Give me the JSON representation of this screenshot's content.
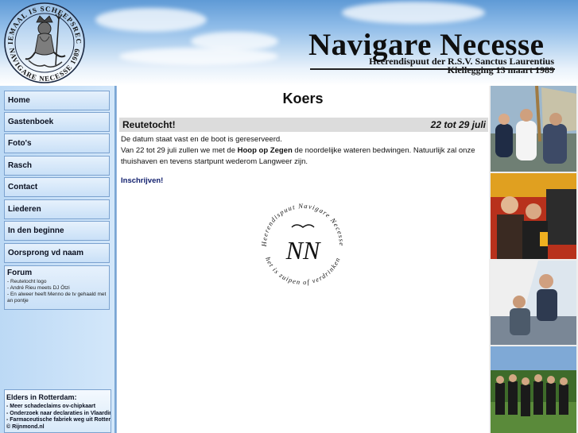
{
  "header": {
    "site_title": "Navigare Necesse",
    "subtitle_line1": "Heerendispuut der R.S.V. Sanctus Laurentius",
    "subtitle_line2": "Kiellegging 13 maart 1989",
    "logo_text_top": "DRIEMAAL IS SCHEEPSRECHT",
    "logo_text_bottom": "NAVIGARE NECESSE 1989"
  },
  "nav": {
    "items": [
      "Home",
      "Gastenboek",
      "Foto's",
      "Rasch",
      "Contact",
      "Liederen",
      "In den beginne",
      "Oorsprong vd naam"
    ]
  },
  "forum": {
    "title": "Forum",
    "links": [
      "- Reutetocht logo",
      "- André Rieu meets DJ Ötzi",
      "- En alweer heeft Menno de tv gehaald met an pontje"
    ]
  },
  "elders": {
    "title": "Elders in Rotterdam:",
    "links": [
      "- Meer schadeclaims ov-chipkaart",
      "- Onderzoek naar declaraties in Vlaardingen",
      "- Farmaceutische fabriek weg uit Rotterdam",
      "© Rijnmond.nl"
    ]
  },
  "main": {
    "page_title": "Koers",
    "news_title": "Reutetocht!",
    "news_date": "22 tot 29 juli",
    "line1": "De datum staat vast en de boot is gereserveerd.",
    "line2_pre": "Van 22 tot 29 juli zullen we met de ",
    "line2_bold": "Hoop op Zegen",
    "line2_post": " de noordelijke wateren bedwingen. Natuurlijk zal onze",
    "line3": "thuishaven en tevens startpunt wederom Langweer zijn.",
    "signup_link": "Inschrijven!"
  },
  "emblem": {
    "initials": "NN",
    "ring_top": "Heerendispuut Navigare Necesse",
    "ring_bottom": "het is zuipen of verdrinken"
  },
  "colors": {
    "sidebar_bg": "#c9e0f7",
    "button_border": "#7ba2cf",
    "news_bar": "#dcdcdc",
    "link": "#12206e"
  }
}
